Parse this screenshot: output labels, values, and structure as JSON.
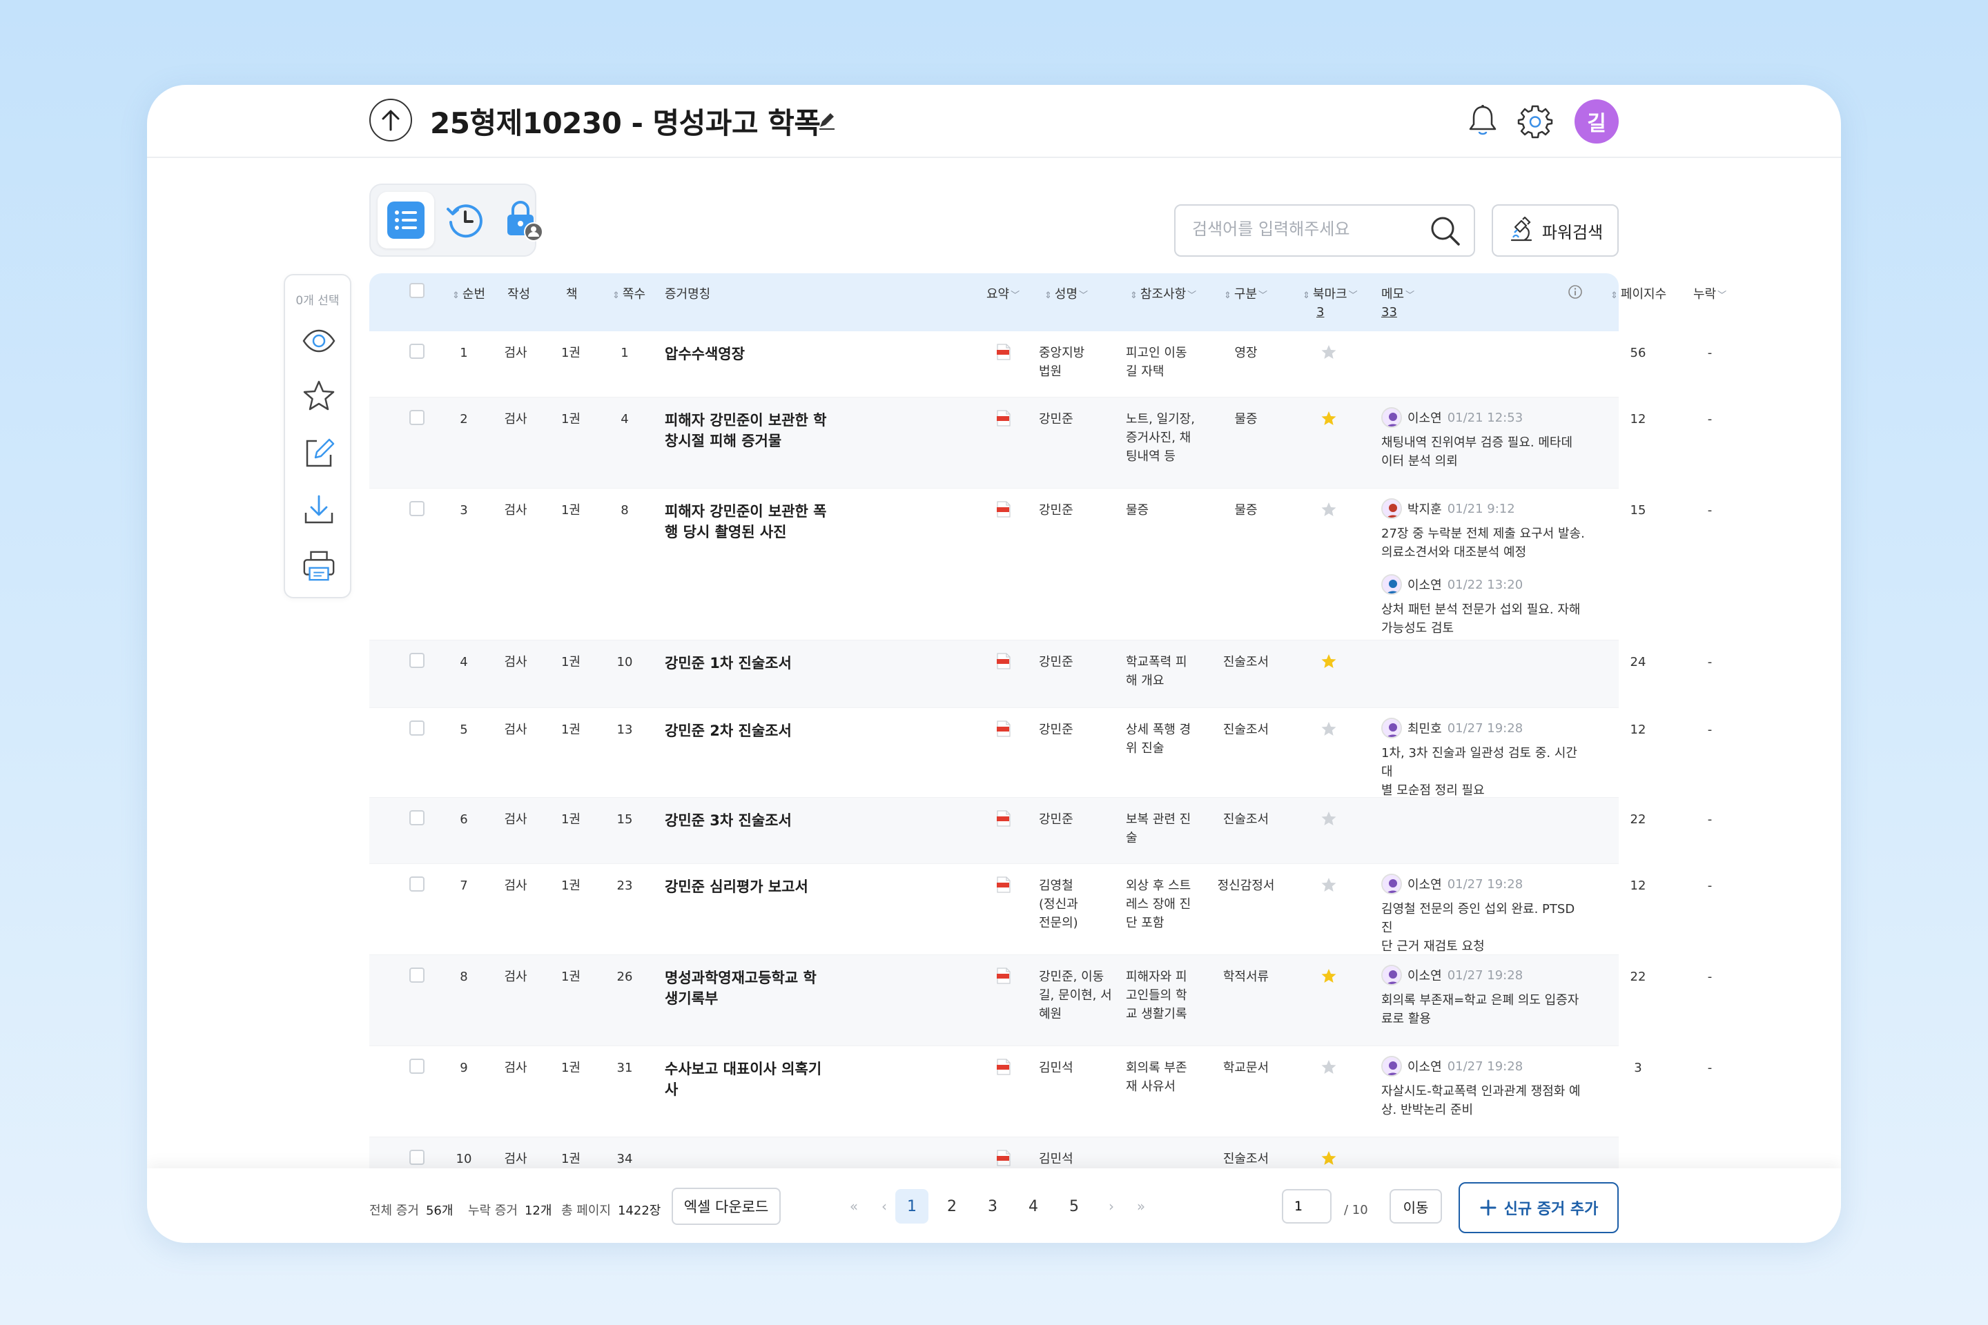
{
  "header": {
    "title": "25형제10230 - 명성과고 학폭",
    "avatar_initial": "길"
  },
  "search": {
    "placeholder": "검색어를 입력해주세요",
    "power_label": "파워검색"
  },
  "sidebar": {
    "selected_label": "0개 선택"
  },
  "columns": {
    "seq": "순번",
    "author": "작성",
    "book": "책",
    "page": "쪽수",
    "name": "증거명칭",
    "summary": "요약",
    "person": "성명",
    "ref": "참조사항",
    "type": "구분",
    "bookmark": "북마크",
    "bookmark_count": "3",
    "memo": "메모",
    "memo_count": "33",
    "pages": "페이지수",
    "missing": "누락"
  },
  "rows": [
    {
      "seq": "1",
      "author": "검사",
      "book": "1권",
      "page": "1",
      "name": "압수수색영장",
      "person": "중앙지방\n법원",
      "ref": "피고인 이동\n길 자택",
      "type": "영장",
      "starred": false,
      "memos": [],
      "pages": "56",
      "missing": "-"
    },
    {
      "seq": "2",
      "author": "검사",
      "book": "1권",
      "page": "4",
      "name": "피해자 강민준이 보관한 학\n창시절 피해 증거물",
      "person": "강민준",
      "ref": "노트, 일기장,\n증거사진, 채\n팅내역 등",
      "type": "물증",
      "starred": true,
      "memos": [
        {
          "author": "이소연",
          "time": "01/21 12:53",
          "text": "채팅내역 진위여부 검증 필요. 메타데\n이터 분석 의뢰"
        }
      ],
      "pages": "12",
      "missing": "-"
    },
    {
      "seq": "3",
      "author": "검사",
      "book": "1권",
      "page": "8",
      "name": "피해자 강민준이 보관한 폭\n행 당시 촬영된 사진",
      "person": "강민준",
      "ref": "물증",
      "type": "물증",
      "starred": false,
      "memos": [
        {
          "author": "박지훈",
          "time": "01/21 9:12",
          "text": "27장 중 누락분 전체 제출 요구서 발송.\n의료소견서와 대조분석 예정"
        },
        {
          "author": "이소연",
          "time": "01/22 13:20",
          "text": "상처 패턴 분석 전문가 섭외 필요. 자해\n가능성도 검토"
        }
      ],
      "pages": "15",
      "missing": "-"
    },
    {
      "seq": "4",
      "author": "검사",
      "book": "1권",
      "page": "10",
      "name": "강민준 1차 진술조서",
      "person": "강민준",
      "ref": "학교폭력 피\n해 개요",
      "type": "진술조서",
      "starred": true,
      "memos": [],
      "pages": "24",
      "missing": "-"
    },
    {
      "seq": "5",
      "author": "검사",
      "book": "1권",
      "page": "13",
      "name": "강민준 2차 진술조서",
      "person": "강민준",
      "ref": "상세 폭행 경\n위 진술",
      "type": "진술조서",
      "starred": false,
      "memos": [
        {
          "author": "최민호",
          "time": "01/27 19:28",
          "text": "1차, 3차 진술과 일관성 검토 중. 시간대\n별 모순점 정리 필요"
        }
      ],
      "pages": "12",
      "missing": "-"
    },
    {
      "seq": "6",
      "author": "검사",
      "book": "1권",
      "page": "15",
      "name": "강민준 3차 진술조서",
      "person": "강민준",
      "ref": "보복 관련 진\n술",
      "type": "진술조서",
      "starred": false,
      "memos": [],
      "pages": "22",
      "missing": "-"
    },
    {
      "seq": "7",
      "author": "검사",
      "book": "1권",
      "page": "23",
      "name": "강민준 심리평가 보고서",
      "person": "김영철\n(정신과\n전문의)",
      "ref": "외상 후 스트\n레스 장애 진\n단 포함",
      "type": "정신감정서",
      "starred": false,
      "memos": [
        {
          "author": "이소연",
          "time": "01/27 19:28",
          "text": "김영철 전문의 증인 섭외 완료. PTSD 진\n단 근거 재검토 요청"
        }
      ],
      "pages": "12",
      "missing": "-"
    },
    {
      "seq": "8",
      "author": "검사",
      "book": "1권",
      "page": "26",
      "name": "명성과학영재고등학교 학\n생기록부",
      "person": "강민준, 이동\n길, 문이현, 서\n혜원",
      "ref": "피해자와 피\n고인들의 학\n교 생활기록",
      "type": "학적서류",
      "starred": true,
      "memos": [
        {
          "author": "이소연",
          "time": "01/27 19:28",
          "text": "회의록 부존재=학교 은폐 의도 입증자\n료로 활용"
        }
      ],
      "pages": "22",
      "missing": "-"
    },
    {
      "seq": "9",
      "author": "검사",
      "book": "1권",
      "page": "31",
      "name": "수사보고 대표이사 의혹기\n사",
      "person": "김민석",
      "ref": "회의록 부존\n재 사유서",
      "type": "학교문서",
      "starred": false,
      "memos": [
        {
          "author": "이소연",
          "time": "01/27 19:28",
          "text": "자살시도-학교폭력 인과관계 쟁점화 예\n상. 반박논리 준비"
        }
      ],
      "pages": "3",
      "missing": "-"
    },
    {
      "seq": "10",
      "author": "검사",
      "book": "1권",
      "page": "34",
      "name": "",
      "person": "김민석",
      "ref": "",
      "type": "진술조서",
      "starred": true,
      "memos": [],
      "pages": "",
      "missing": ""
    }
  ],
  "footer": {
    "total_label": "전체 증거",
    "total_value": "56개",
    "missing_label": "누락 증거",
    "missing_value": "12개",
    "pages_label": "총 페이지",
    "pages_value": "1422장",
    "excel_label": "엑셀 다운로드",
    "pages": [
      "1",
      "2",
      "3",
      "4",
      "5"
    ],
    "first": "«",
    "prev": "‹",
    "next": "›",
    "last": "»",
    "page_input": "1",
    "page_total": "/ 10",
    "go_label": "이동",
    "add_label": "신규 증거 추가"
  },
  "colors": {
    "accent": "#1d5fa8",
    "header_bg": "#e4f0fc",
    "star_on": "#f5c518",
    "star_off": "#cfd3d8",
    "avatar": "#b86be8"
  }
}
